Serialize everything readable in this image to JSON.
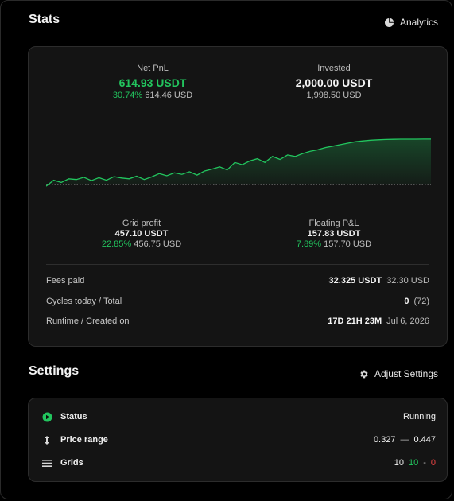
{
  "stats": {
    "title": "Stats",
    "analytics_label": "Analytics"
  },
  "summary": {
    "net_pnl": {
      "label": "Net PnL",
      "value": "614.93 USDT",
      "pct": "30.74%",
      "usd": "614.46 USD"
    },
    "invested": {
      "label": "Invested",
      "value": "2,000.00 USDT",
      "usd": "1,998.50 USD"
    },
    "grid_profit": {
      "label": "Grid profit",
      "value": "457.10 USDT",
      "pct": "22.85%",
      "usd": "456.75 USD"
    },
    "floating_pl": {
      "label": "Floating P&L",
      "value": "157.83 USDT",
      "pct": "7.89%",
      "usd": "157.70 USD"
    }
  },
  "details": {
    "fees": {
      "label": "Fees paid",
      "value": "32.325 USDT",
      "usd": "32.30 USD"
    },
    "cycles": {
      "label": "Cycles today / Total",
      "today": "0",
      "total": "(72)"
    },
    "runtime": {
      "label": "Runtime / Created on",
      "value": "17D 21H 23M",
      "created": "Jul 6, 2026"
    }
  },
  "settings": {
    "title": "Settings",
    "adjust_label": "Adjust Settings",
    "status": {
      "label": "Status",
      "value": "Running"
    },
    "price_range": {
      "label": "Price range",
      "low": "0.327",
      "sep": "—",
      "high": "0.447"
    },
    "grids": {
      "label": "Grids",
      "total": "10",
      "buy": "10",
      "dash": "-",
      "sell": "0"
    }
  },
  "colors": {
    "accent_green": "#22c55e",
    "accent_red": "#ef4444",
    "card_bg": "#141414"
  },
  "chart_data": {
    "type": "area",
    "title": "",
    "xlabel": "",
    "ylabel": "",
    "baseline": 0,
    "ylim": [
      -30,
      700
    ],
    "values": [
      -20,
      60,
      30,
      80,
      70,
      100,
      55,
      95,
      60,
      110,
      90,
      80,
      115,
      70,
      105,
      150,
      120,
      160,
      140,
      175,
      130,
      185,
      210,
      240,
      200,
      300,
      270,
      320,
      350,
      300,
      380,
      340,
      400,
      380,
      420,
      450,
      470,
      500,
      520,
      540,
      560,
      580,
      590,
      600,
      605,
      610,
      612,
      614,
      614,
      614,
      615,
      615
    ]
  }
}
